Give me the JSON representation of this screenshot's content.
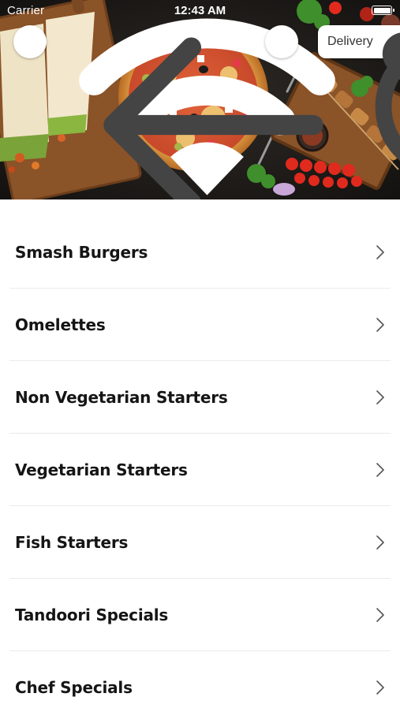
{
  "status_bar": {
    "carrier": "Carrier",
    "time": "12:43 AM"
  },
  "header": {
    "back_icon": "arrow-left-icon",
    "search_icon": "search-icon",
    "delivery_label": "Delivery",
    "delivery_icon": "chevron-down-icon"
  },
  "categories": [
    {
      "label": "Smash Burgers"
    },
    {
      "label": "Omelettes"
    },
    {
      "label": "Non Vegetarian Starters"
    },
    {
      "label": "Vegetarian Starters"
    },
    {
      "label": "Fish Starters"
    },
    {
      "label": "Tandoori Specials"
    },
    {
      "label": "Chef Specials"
    }
  ],
  "colors": {
    "background": "#ffffff",
    "text": "#151515",
    "chevron": "#555555",
    "divider": "#ebebeb"
  }
}
